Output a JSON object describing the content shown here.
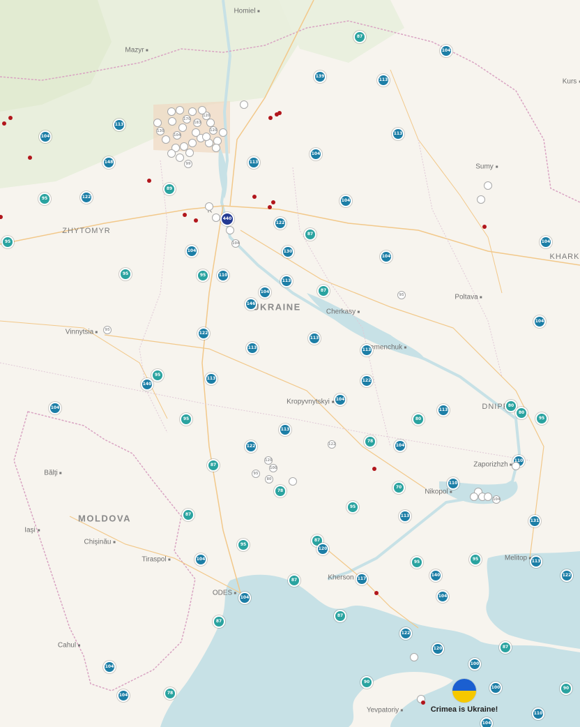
{
  "map": {
    "colors": {
      "land": "#f7f4ee",
      "forest": "#e4ecd5",
      "water": "#c7e1e6",
      "border": "#d9a3c2",
      "road": "#f2c88a",
      "marker_teal": "#2aa3a0",
      "marker_blue": "#1c7ea6",
      "marker_gray": "#a8a8a8",
      "cluster_navy": "#233a93",
      "incident_dot": "#b1161c"
    },
    "country_labels": [
      "UKRAINE",
      "MOLDOVA"
    ],
    "region_labels": [
      "ZHYTOMYR",
      "KHARK",
      "DNIPR"
    ],
    "cities": [
      "Homiel",
      "Mazyr",
      "Kurs",
      "Sumy",
      "Poltava",
      "Cherkasy",
      "Vinnytsia",
      "Kremenchuk",
      "Kropyvnytskyi",
      "Zaporizhzh",
      "Nikopol",
      "Bălţi",
      "Iaşi",
      "Chişinău",
      "Tiraspol",
      "Melitop",
      "Kherson",
      "ODES",
      "Cahul",
      "Yevpatoriy",
      "K"
    ],
    "markers": {
      "teal": [
        "87",
        "95",
        "95",
        "95",
        "95",
        "95",
        "95",
        "89",
        "87",
        "87",
        "87",
        "87",
        "87",
        "87",
        "87",
        "87",
        "78",
        "78",
        "78",
        "70",
        "80",
        "80",
        "80",
        "95",
        "95",
        "95",
        "95",
        "90",
        "90",
        "87",
        "95"
      ],
      "blue": [
        "104",
        "139",
        "113",
        "113",
        "104",
        "113",
        "104",
        "148",
        "113",
        "104",
        "122",
        "122",
        "104",
        "130",
        "104",
        "110",
        "104",
        "113",
        "146",
        "122",
        "113",
        "113",
        "113",
        "140",
        "113",
        "104",
        "113",
        "122",
        "104",
        "122",
        "113",
        "104",
        "140",
        "104",
        "104",
        "131",
        "113",
        "122",
        "104",
        "120",
        "100",
        "100",
        "104",
        "110",
        "110",
        "104",
        "120",
        "117",
        "113",
        "104",
        "104",
        "104",
        "122",
        "110"
      ],
      "gray": [
        "104",
        "170",
        "183",
        "120",
        "120",
        "130",
        "99",
        "104",
        "95",
        "95",
        "122",
        "120",
        "100",
        "95",
        "80",
        "104"
      ],
      "cluster": "440"
    },
    "crimea_message": "Crimea is Ukraine!"
  }
}
